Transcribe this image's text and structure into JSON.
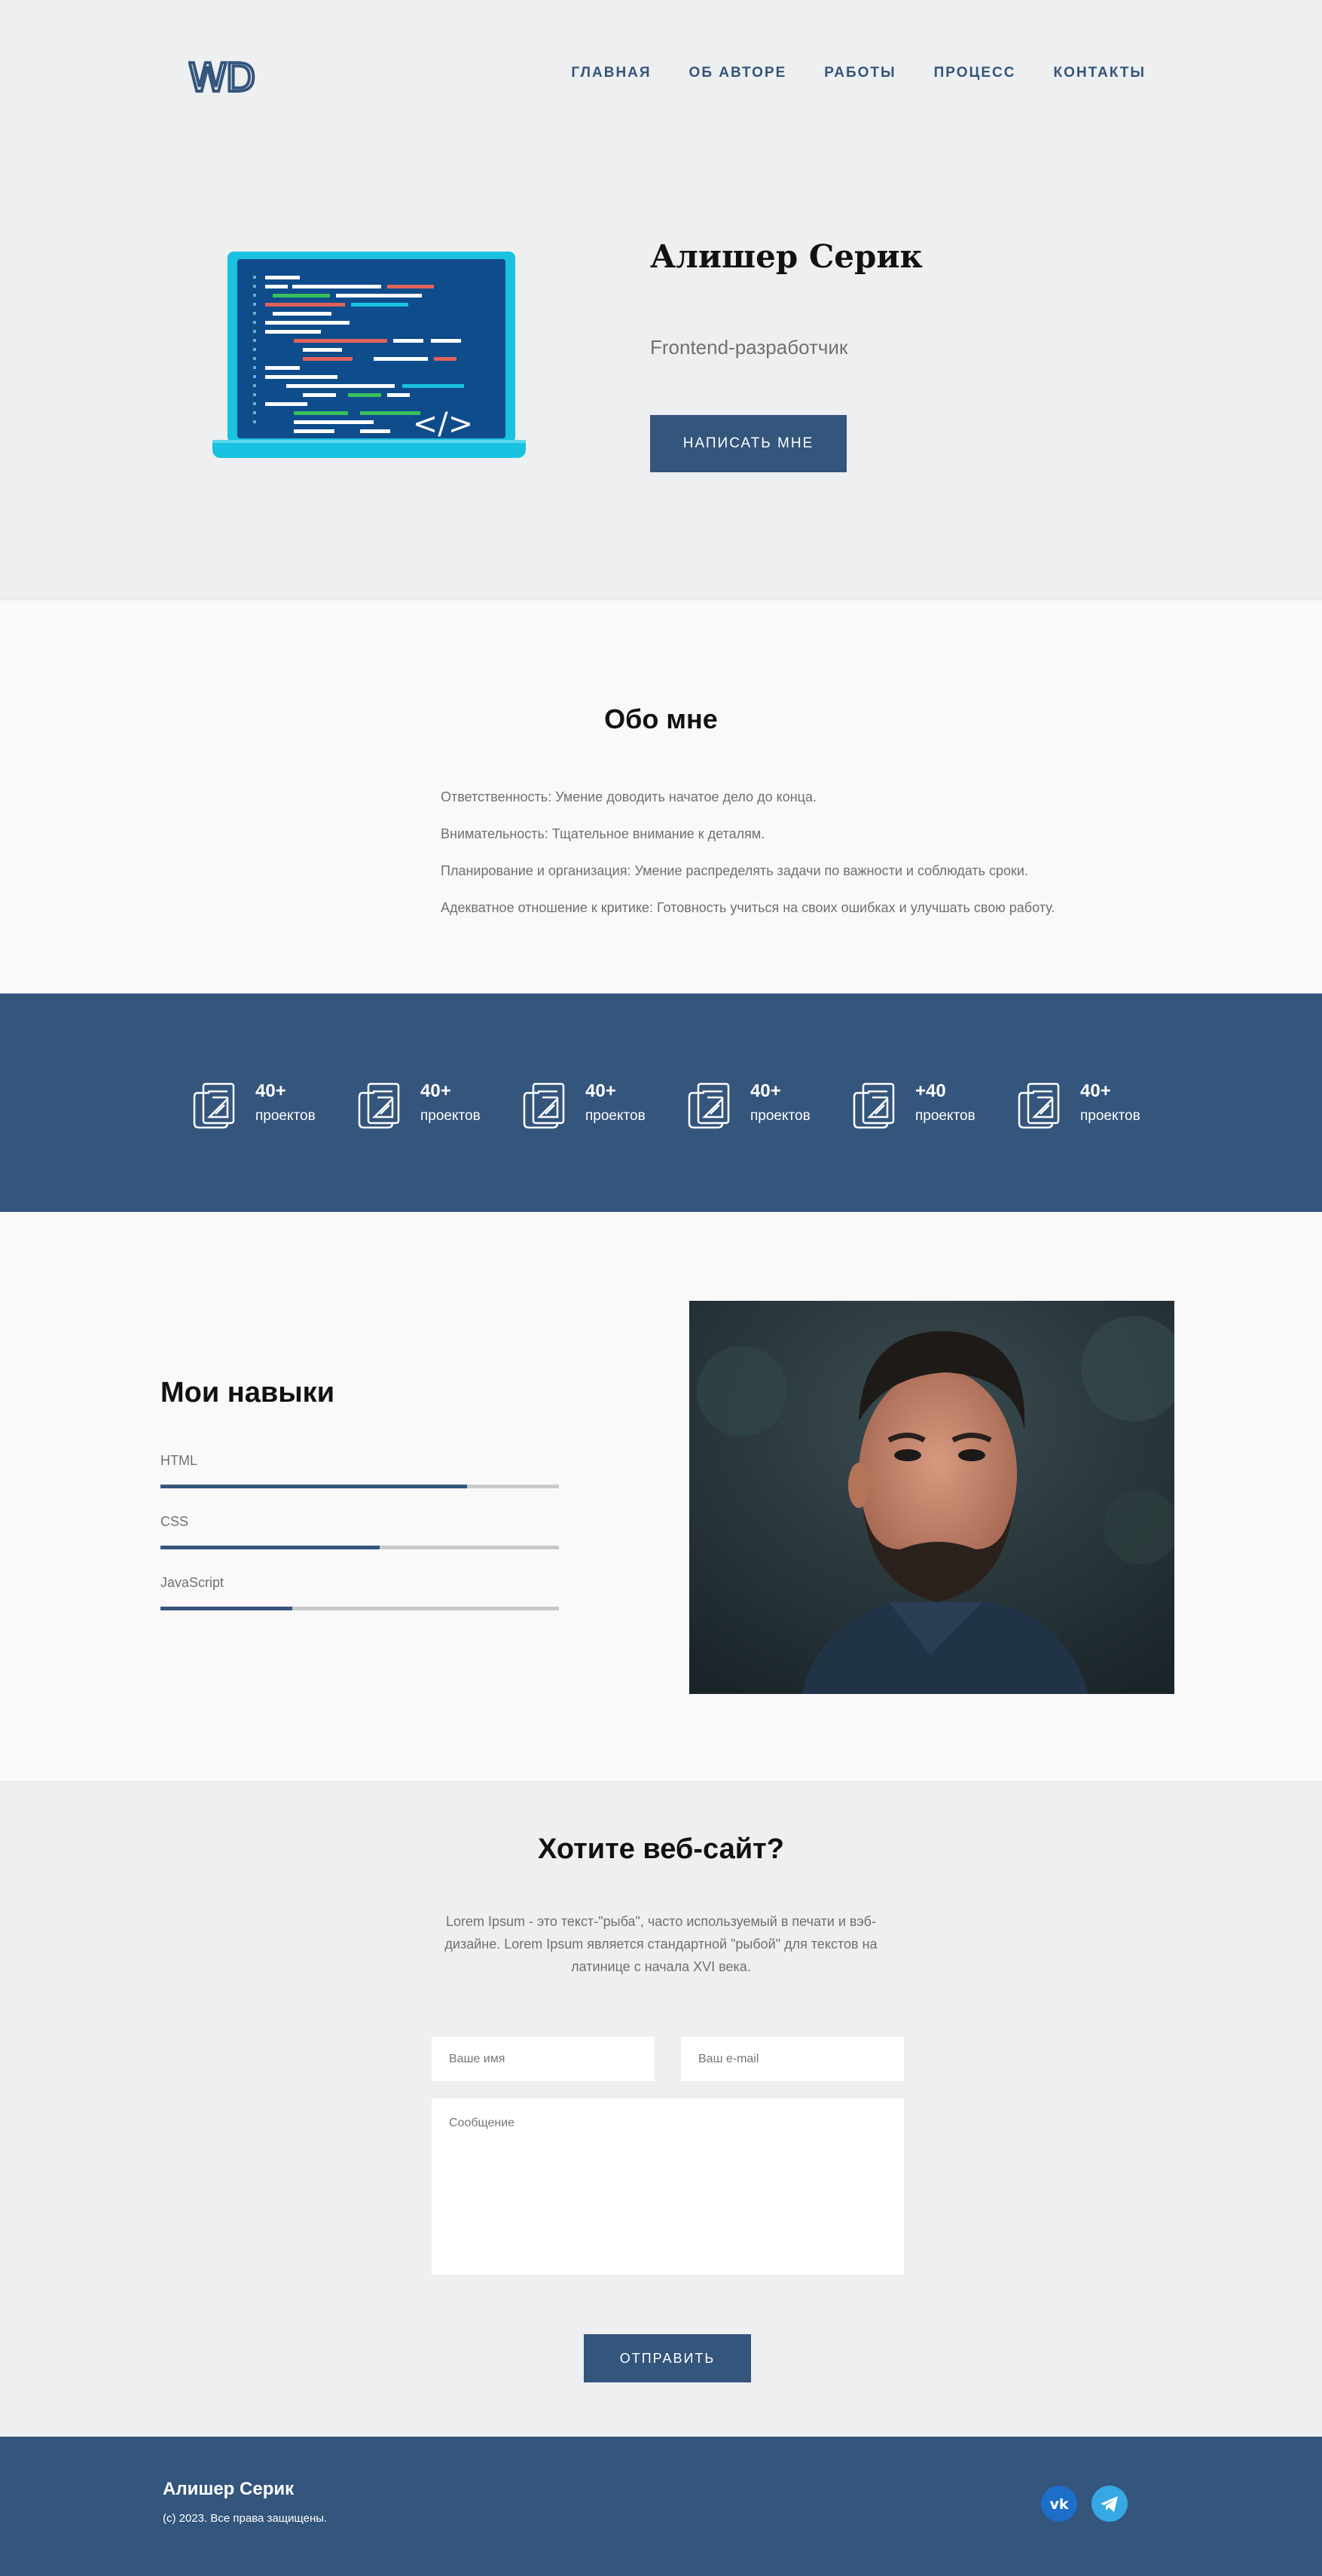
{
  "header": {
    "logo_text": "WD",
    "nav": [
      "Главная",
      "Об авторе",
      "Работы",
      "Процесс",
      "Контакты"
    ]
  },
  "hero": {
    "name": "Алишер Серик",
    "role": "Frontend-разработчик",
    "button": "Написать мне",
    "illustration_code_tag": "</>"
  },
  "about": {
    "title": "Обо мне",
    "items": [
      "Ответственность: Умение доводить начатое дело до конца.",
      "Внимательность: Тщательное внимание к деталям.",
      "Планирование и организация: Умение распределять задачи по важности и соблюдать сроки.",
      "Адекватное отношение к критике: Готовность учиться на своих ошибках и улучшать свою работу."
    ]
  },
  "stats": [
    {
      "value": "40+",
      "label": "проектов",
      "icon": "blueprint-icon"
    },
    {
      "value": "40+",
      "label": "проектов",
      "icon": "blueprint-icon"
    },
    {
      "value": "40+",
      "label": "проектов",
      "icon": "blueprint-icon"
    },
    {
      "value": "40+",
      "label": "проектов",
      "icon": "blueprint-icon"
    },
    {
      "value": "+40",
      "label": "проектов",
      "icon": "blueprint-icon"
    },
    {
      "value": "40+",
      "label": "проектов",
      "icon": "blueprint-icon"
    }
  ],
  "skills": {
    "title": "Мои навыки",
    "items": [
      {
        "name": "HTML",
        "level_percent": 77
      },
      {
        "name": "CSS",
        "level_percent": 55
      },
      {
        "name": "JavaScript",
        "level_percent": 33
      }
    ]
  },
  "contact": {
    "title": "Хотите веб-сайт?",
    "text": "Lorem Ipsum - это текст-\"рыба\", часто используемый в печати и вэб-дизайне. Lorem Ipsum является стандартной \"рыбой\" для текстов на латинице с начала XVI века.",
    "name_placeholder": "Ваше имя",
    "email_placeholder": "Ваш e-mail",
    "message_placeholder": "Сообщение",
    "button": "Отправить"
  },
  "footer": {
    "name": "Алишер Серик",
    "copyright": "(с) 2023. Все права защищены.",
    "social": [
      "vk-icon",
      "telegram-icon"
    ]
  },
  "colors": {
    "accent": "#34557c",
    "page_bg": "#eeeff1",
    "section_bg": "#f9f9fa",
    "vk": "#1d6ec7",
    "telegram": "#36a8e3"
  }
}
